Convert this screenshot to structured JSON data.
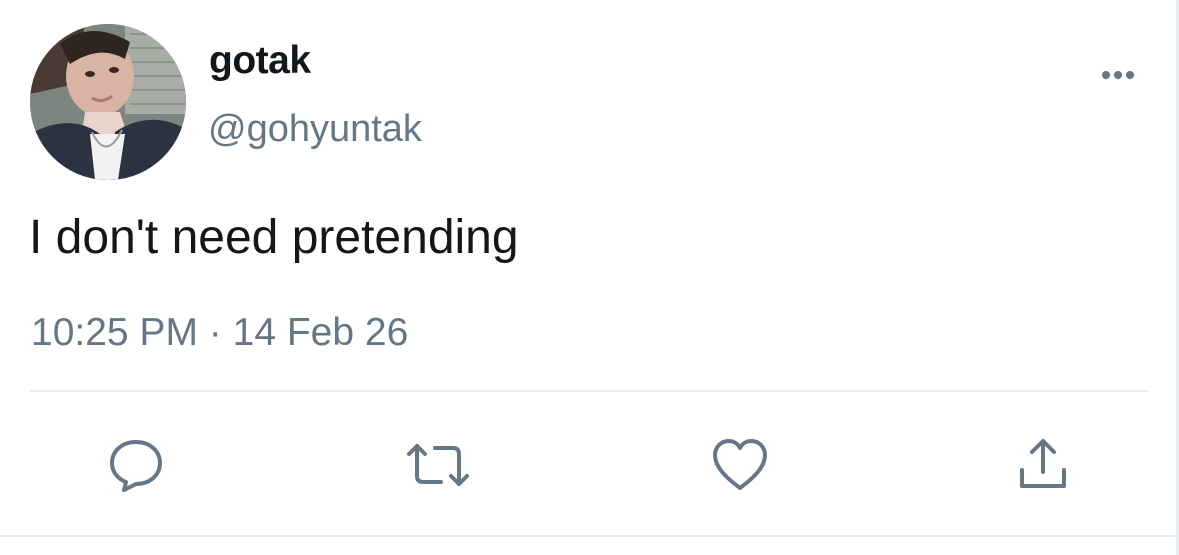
{
  "tweet": {
    "display_name": "gotak",
    "handle": "@gohyuntak",
    "text": "I don't need pretending",
    "time": "10:25 PM",
    "separator": "·",
    "date": "14 Feb 26"
  },
  "actions": [
    {
      "icon": "reply-icon"
    },
    {
      "icon": "retweet-icon"
    },
    {
      "icon": "like-icon"
    },
    {
      "icon": "share-icon"
    }
  ],
  "colors": {
    "text_primary": "#14171a",
    "text_secondary": "#657786",
    "icon": "#657786",
    "divider": "#e6ecf0"
  }
}
